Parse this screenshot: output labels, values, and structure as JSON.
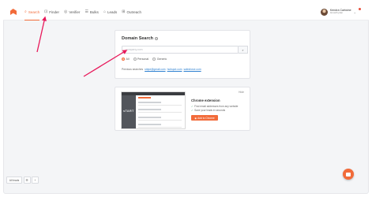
{
  "nav": {
    "items": [
      {
        "label": "Search",
        "icon": "search-icon",
        "active": true
      },
      {
        "label": "Finder",
        "icon": "finder-icon",
        "active": false
      },
      {
        "label": "Verifier",
        "icon": "verifier-icon",
        "active": false
      },
      {
        "label": "Bulks",
        "icon": "bulks-icon",
        "active": false
      },
      {
        "label": "Leads",
        "icon": "leads-icon",
        "active": false
      },
      {
        "label": "Outreach",
        "icon": "outreach-icon",
        "active": false
      }
    ]
  },
  "user": {
    "name": "Kendra Cartwine",
    "plan": "Growth plan"
  },
  "search": {
    "title": "Domain Search",
    "placeholder": "company.com",
    "value": "",
    "filters": [
      "All",
      "Personal",
      "Generic"
    ],
    "selected_filter": "All",
    "previous_label": "Previous searches",
    "previous": [
      "stripe@gmail.com",
      "hubspot.com",
      "salesforce.com"
    ]
  },
  "extension": {
    "dismiss": "Hide",
    "title": "Chrome extension",
    "items": [
      "Find email addresses from any website",
      "Save your leads in seconds"
    ],
    "button": "Add to Chrome"
  },
  "bottom": {
    "select_label": "All leads"
  },
  "colors": {
    "accent": "#f26b3a",
    "arrow": "#e8185a"
  }
}
